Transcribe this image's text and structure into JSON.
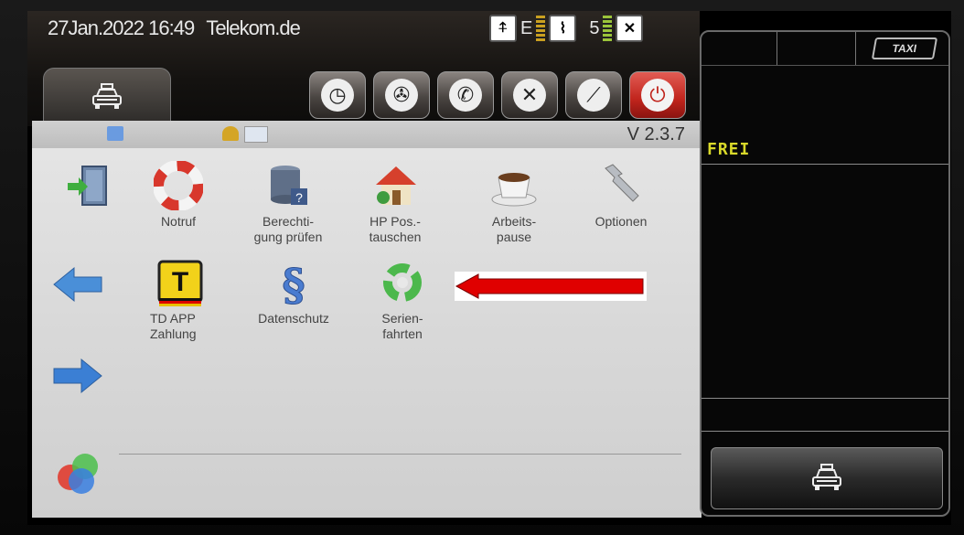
{
  "status": {
    "date": "27Jan.2022",
    "time": "16:49",
    "provider": "Telekom.de",
    "net_label": "E",
    "sat_count": "5"
  },
  "panel": {
    "version": "V 2.3.7"
  },
  "tiles": [
    {
      "label": "Notruf"
    },
    {
      "label": "Berechti-\ngung prüfen"
    },
    {
      "label": "HP Pos.-\ntauschen"
    },
    {
      "label": "Arbeits-\npause"
    },
    {
      "label": "Optionen"
    },
    {
      "label": "TD APP\nZahlung"
    },
    {
      "label": "Datenschutz"
    },
    {
      "label": "Serien-\nfahrten"
    }
  ],
  "right_panel": {
    "taxi_badge": "TAXI",
    "status": "FREI"
  },
  "colors": {
    "accent_red": "#e00000",
    "status_yellow": "#d9d92a"
  }
}
